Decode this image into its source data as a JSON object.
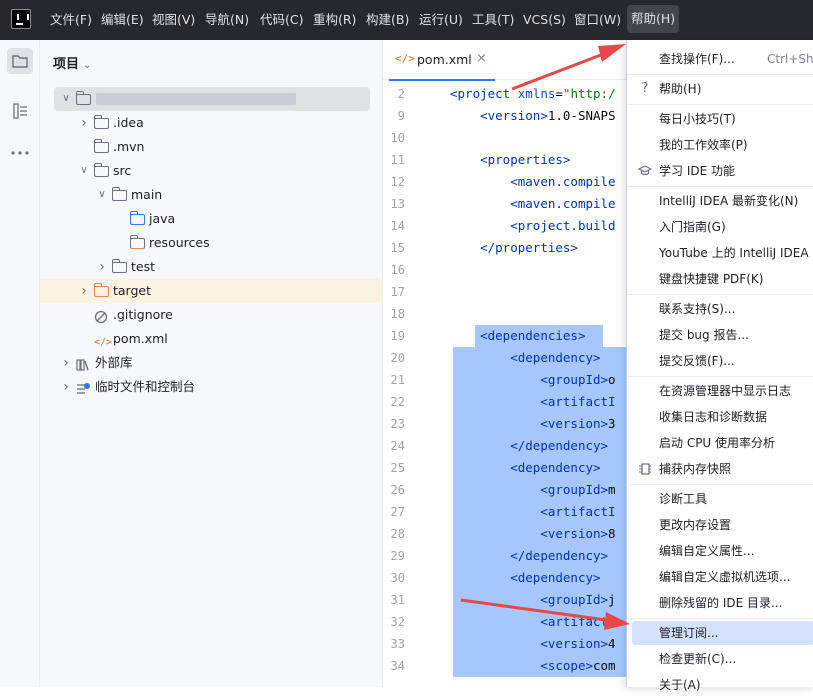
{
  "menubar": {
    "items": [
      "文件(F)",
      "编辑(E)",
      "视图(V)",
      "导航(N)",
      "代码(C)",
      "重构(R)",
      "构建(B)",
      "运行(U)",
      "工具(T)",
      "VCS(S)",
      "窗口(W)",
      "帮助(H)"
    ],
    "active": "帮助(H)"
  },
  "project_panel": {
    "title": "项目",
    "tree": [
      {
        "label": "",
        "depth": 0,
        "expanded": true,
        "type": "module",
        "blurred": true
      },
      {
        "label": ".idea",
        "depth": 1,
        "expanded": false,
        "type": "folder"
      },
      {
        "label": ".mvn",
        "depth": 1,
        "expanded": null,
        "type": "folder"
      },
      {
        "label": "src",
        "depth": 1,
        "expanded": true,
        "type": "folder"
      },
      {
        "label": "main",
        "depth": 2,
        "expanded": true,
        "type": "folder"
      },
      {
        "label": "java",
        "depth": 3,
        "expanded": null,
        "type": "folder-blue"
      },
      {
        "label": "resources",
        "depth": 3,
        "expanded": null,
        "type": "folder-res"
      },
      {
        "label": "test",
        "depth": 2,
        "expanded": false,
        "type": "folder"
      },
      {
        "label": "target",
        "depth": 1,
        "expanded": false,
        "type": "folder-orange"
      },
      {
        "label": ".gitignore",
        "depth": 1,
        "expanded": null,
        "type": "gitignore"
      },
      {
        "label": "pom.xml",
        "depth": 1,
        "expanded": null,
        "type": "xml"
      },
      {
        "label": "外部库",
        "depth": 0,
        "expanded": false,
        "type": "library"
      },
      {
        "label": "临时文件和控制台",
        "depth": 0,
        "expanded": false,
        "type": "scratch"
      }
    ]
  },
  "editor": {
    "tab_label": "pom.xml",
    "line_numbers": [
      "2",
      "9",
      "10",
      "11",
      "12",
      "13",
      "14",
      "15",
      "16",
      "17",
      "18",
      "19",
      "20",
      "21",
      "22",
      "23",
      "24",
      "25",
      "26",
      "27",
      "28",
      "29",
      "30",
      "31",
      "32",
      "33",
      "34"
    ],
    "lines": [
      "<project xmlns=\"http:/",
      "    <version>1.0-SNAPS",
      "",
      "    <properties>",
      "        <maven.compile",
      "        <maven.compile",
      "        <project.build",
      "    </properties>",
      "",
      "",
      "",
      "    <dependencies>",
      "        <dependency>",
      "            <groupId>o",
      "            <artifactI",
      "            <version>3",
      "        </dependency>",
      "        <dependency>",
      "            <groupId>m",
      "            <artifactI",
      "            <version>8",
      "        </dependency>",
      "        <dependency>",
      "            <groupId>j",
      "            <artifactI",
      "            <version>4",
      "            <scope>com"
    ]
  },
  "help_menu": {
    "items": [
      {
        "label": "查找操作(F)...",
        "shortcut": "Ctrl+Shi",
        "icon": ""
      },
      {
        "sep": true
      },
      {
        "label": "帮助(H)",
        "icon": "?"
      },
      {
        "sep": true
      },
      {
        "label": "每日小技巧(T)",
        "icon": ""
      },
      {
        "label": "我的工作效率(P)",
        "icon": ""
      },
      {
        "label": "学习 IDE 功能",
        "icon": "graduation-cap"
      },
      {
        "sep": true
      },
      {
        "label": "IntelliJ IDEA 最新变化(N)",
        "icon": ""
      },
      {
        "label": "入门指南(G)",
        "icon": ""
      },
      {
        "label": "YouTube 上的 IntelliJ IDEA",
        "icon": ""
      },
      {
        "label": "键盘快捷键 PDF(K)",
        "icon": ""
      },
      {
        "sep": true
      },
      {
        "label": "联系支持(S)...",
        "icon": ""
      },
      {
        "label": "提交 bug 报告...",
        "icon": ""
      },
      {
        "label": "提交反馈(F)...",
        "icon": ""
      },
      {
        "sep": true
      },
      {
        "label": "在资源管理器中显示日志",
        "icon": ""
      },
      {
        "label": "收集日志和诊断数据",
        "icon": ""
      },
      {
        "label": "启动 CPU 使用率分析",
        "icon": ""
      },
      {
        "label": "捕获内存快照",
        "icon": "memory"
      },
      {
        "sep": true
      },
      {
        "label": "诊断工具",
        "icon": ""
      },
      {
        "label": "更改内存设置",
        "icon": ""
      },
      {
        "label": "编辑自定义属性...",
        "icon": ""
      },
      {
        "label": "编辑自定义虚拟机选项...",
        "icon": ""
      },
      {
        "label": "删除残留的 IDE 目录...",
        "icon": ""
      },
      {
        "sep": true
      },
      {
        "label": "管理订阅...",
        "icon": "",
        "highlighted": true
      },
      {
        "label": "检查更新(C)...",
        "icon": ""
      },
      {
        "label": "关于(A)",
        "icon": ""
      }
    ]
  },
  "colors": {
    "accent": "#3574f0",
    "annotation_arrow": "#e8474a",
    "selection": "#a6c7ff",
    "menu_highlight": "#d4e2ff"
  }
}
